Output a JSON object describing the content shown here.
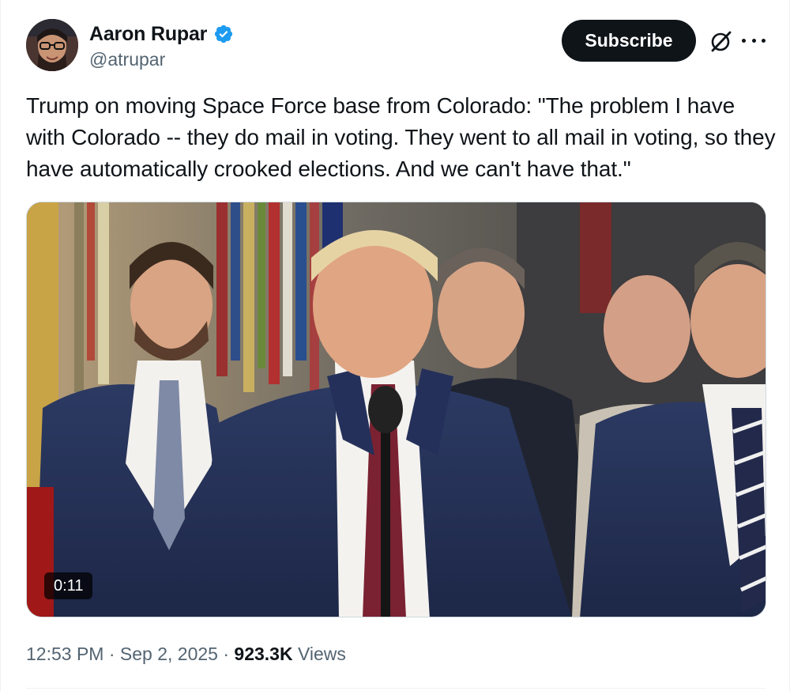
{
  "author": {
    "display_name": "Aaron Rupar",
    "handle": "@atrupar",
    "verified": true,
    "avatar_icon": "profile-photo"
  },
  "actions": {
    "subscribe_label": "Subscribe",
    "grok_icon": "grok-icon",
    "more_icon": "more-horizontal-icon"
  },
  "tweet": {
    "text": "Trump on moving Space Force base from Colorado: \"The problem I have with Colorado -- they do mail in voting. They went to all mail in voting, so they have automatically crooked elections. And we can't have that.\""
  },
  "media": {
    "type": "video",
    "duration": "0:11"
  },
  "meta": {
    "time": "12:53 PM",
    "separator": "·",
    "date": "Sep 2, 2025",
    "views_count": "923.3K",
    "views_label": "Views"
  },
  "colors": {
    "text_primary": "#0f1419",
    "text_secondary": "#536471",
    "verified_blue": "#1d9bf0",
    "border": "#cfd9de"
  }
}
